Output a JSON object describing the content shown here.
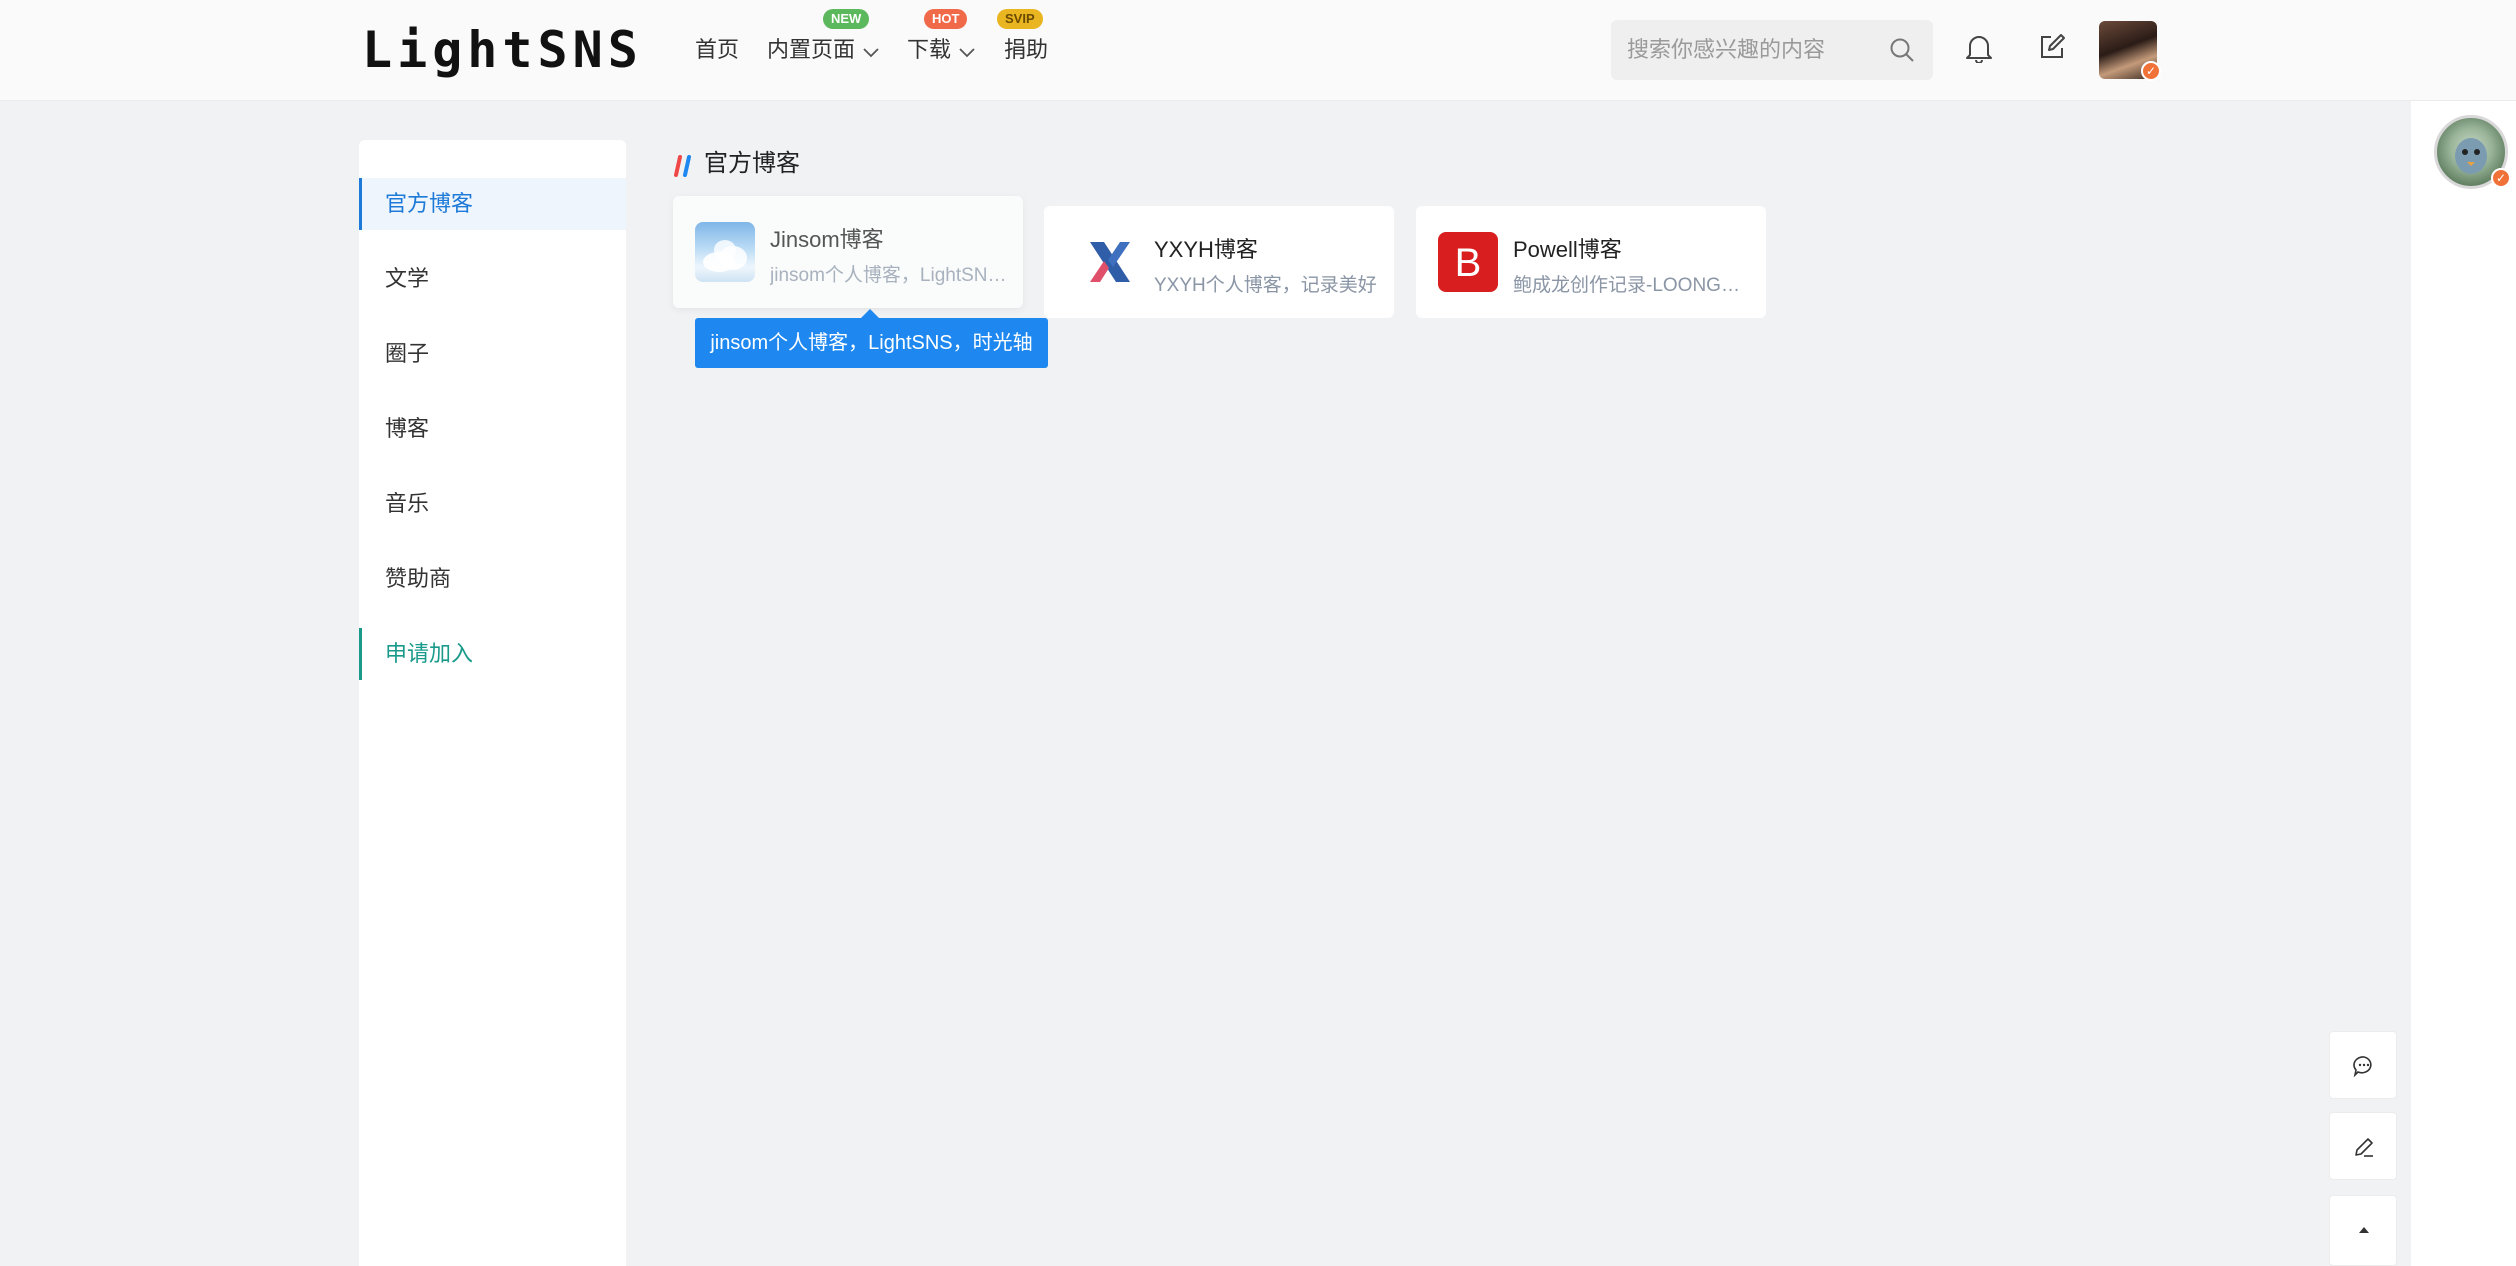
{
  "header": {
    "logo": "LightSNS",
    "nav": [
      {
        "label": "首页"
      },
      {
        "label": "内置页面",
        "badge": "NEW"
      },
      {
        "label": "下载",
        "badge": "HOT"
      },
      {
        "label": "捐助",
        "badge": "SVIP"
      }
    ],
    "search_placeholder": "搜索你感兴趣的内容",
    "icons": [
      "search-icon",
      "bell-icon",
      "edit-icon",
      "avatar"
    ]
  },
  "sidebar": {
    "items": [
      {
        "label": "官方博客",
        "active": true
      },
      {
        "label": "文学"
      },
      {
        "label": "圈子"
      },
      {
        "label": "博客"
      },
      {
        "label": "音乐"
      },
      {
        "label": "赞助商"
      },
      {
        "label": "申请加入",
        "accent": true
      }
    ]
  },
  "main": {
    "section_title": "官方博客",
    "cards": [
      {
        "name": "Jinsom博客",
        "desc": "jinsom个人博客，LightSNS，时光轴",
        "logo": "cloud-logo"
      },
      {
        "name": "YXYH博客",
        "desc": "YXYH个人博客，记录美好",
        "logo": "x-logo"
      },
      {
        "name": "Powell博客",
        "desc": "鲍成龙创作记录-LOONG主题",
        "logo": "b-logo"
      }
    ],
    "tooltip": "jinsom个人博客，LightSNS，时光轴"
  },
  "colors": {
    "accent_blue": "#1e7ad8",
    "accent_teal": "#1a9a8a",
    "tooltip_bg": "#1e88f0",
    "badge_new": "#5cb85c",
    "badge_hot": "#f06a4a",
    "badge_svip": "#e9b520"
  },
  "float_buttons": [
    "comment-icon",
    "pen-icon",
    "back-to-top-icon"
  ]
}
